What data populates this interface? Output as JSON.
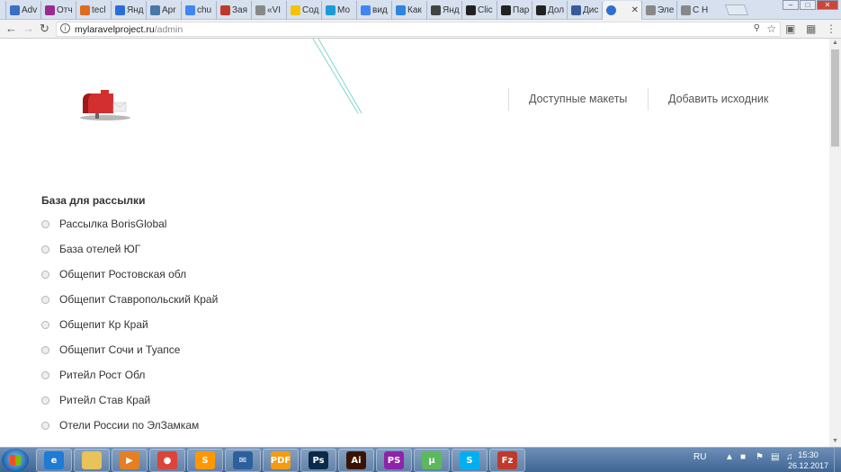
{
  "browser": {
    "tabs": [
      {
        "label": "Adv",
        "color": "#3b6ec4",
        "icon": "adwords-icon"
      },
      {
        "label": "Отч",
        "color": "#9b2c8f",
        "icon": "metrica-icon"
      },
      {
        "label": "tecl",
        "color": "#e06b1f",
        "icon": "chart-icon"
      },
      {
        "label": "Янд",
        "color": "#2a6dd9",
        "icon": "yandex-icon"
      },
      {
        "label": "Apr",
        "color": "#4a76a8",
        "icon": "vk-icon"
      },
      {
        "label": "chu",
        "color": "#4285f4",
        "icon": "google-icon"
      },
      {
        "label": "Зая",
        "color": "#c0392b",
        "icon": "kb-icon"
      },
      {
        "label": "«VI",
        "color": "#888888",
        "icon": "page-icon"
      },
      {
        "label": "Сод",
        "color": "#f4c20d",
        "icon": "yellow-icon"
      },
      {
        "label": "Мо",
        "color": "#1a9bd7",
        "icon": "mo-icon"
      },
      {
        "label": "вид",
        "color": "#4285f4",
        "icon": "google-icon"
      },
      {
        "label": "Как",
        "color": "#2e86de",
        "icon": "triangle-icon"
      },
      {
        "label": "Янд",
        "color": "#444444",
        "icon": "reload-icon"
      },
      {
        "label": "Clic",
        "color": "#222222",
        "icon": "clickup-icon"
      },
      {
        "label": "Пар",
        "color": "#222222",
        "icon": "k-icon"
      },
      {
        "label": "Дол",
        "color": "#222222",
        "icon": "k-icon"
      },
      {
        "label": "Дис",
        "color": "#3b5998",
        "icon": "window-icon"
      },
      {
        "label": "",
        "color": "#2f6fd0",
        "icon": "active-site-icon",
        "close": "✕"
      },
      {
        "label": "Эле",
        "color": "#888888",
        "icon": "page-icon"
      },
      {
        "label": "С Н",
        "color": "#888888",
        "icon": "page-icon"
      }
    ],
    "url_host": "mylaravelproject.ru",
    "url_path": "/admin",
    "window_controls": [
      "–",
      "□",
      "✕"
    ]
  },
  "site": {
    "nav": [
      {
        "label": "Доступные макеты"
      },
      {
        "label": "Добавить исходник"
      }
    ],
    "section_title": "База для рассылки",
    "lists": [
      "Рассылка BorisGlobal",
      "База отелей ЮГ",
      "Общепит Ростовская обл",
      "Общепит Ставропольский Край",
      "Общепит Кр Край",
      "Общепит Сочи и Туапсе",
      "Ритейл Рост Обл",
      "Ритейл Став Край",
      "Отели России по ЭлЗамкам"
    ]
  },
  "taskbar": {
    "apps": [
      {
        "icon": "ie-icon",
        "glyph": "e",
        "color": "#1f7bd4"
      },
      {
        "icon": "folder-icon",
        "glyph": "",
        "color": "#e8c35a"
      },
      {
        "icon": "media-player-icon",
        "glyph": "▶",
        "color": "#e67e22"
      },
      {
        "icon": "chrome-icon",
        "glyph": "●",
        "color": "#db4437"
      },
      {
        "icon": "sublime-icon",
        "glyph": "S",
        "color": "#ff9800"
      },
      {
        "icon": "thunderbird-icon",
        "glyph": "✉",
        "color": "#2c5f9e"
      },
      {
        "icon": "pdf-icon",
        "glyph": "PDF",
        "color": "#f39c12"
      },
      {
        "icon": "photoshop-icon",
        "glyph": "Ps",
        "color": "#0b2a4a"
      },
      {
        "icon": "illustrator-icon",
        "glyph": "Ai",
        "color": "#3a1300"
      },
      {
        "icon": "phpstorm-icon",
        "glyph": "PS",
        "color": "#8e24aa"
      },
      {
        "icon": "utorrent-icon",
        "glyph": "µ",
        "color": "#5cb85c"
      },
      {
        "icon": "skype-icon",
        "glyph": "S",
        "color": "#00aff0"
      },
      {
        "icon": "filezilla-icon",
        "glyph": "Fz",
        "color": "#c0392b"
      }
    ],
    "lang": "RU",
    "time": "15:30",
    "date": "26.12.2017"
  }
}
